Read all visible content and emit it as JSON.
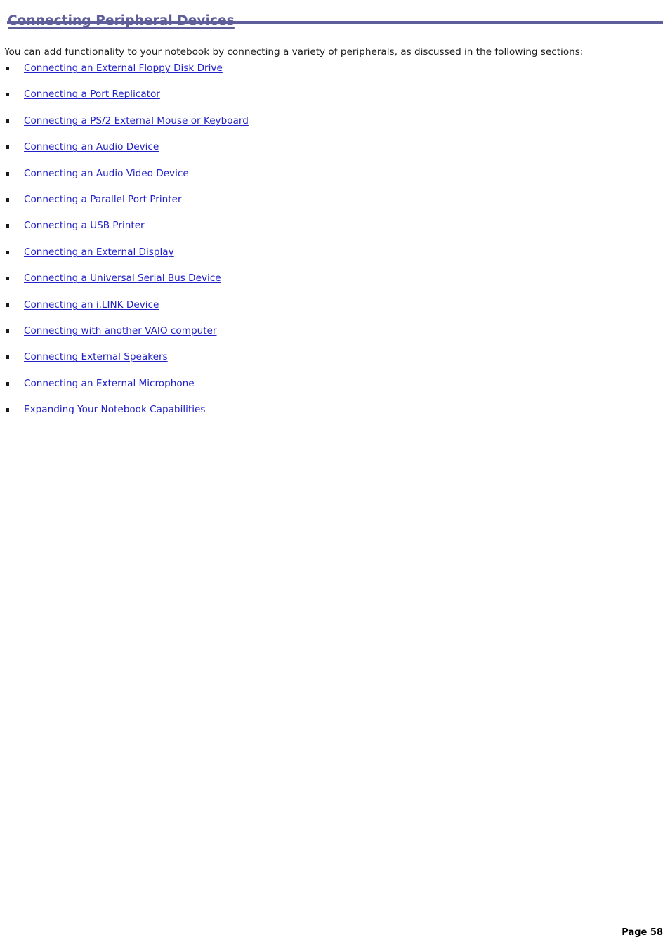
{
  "document": {
    "heading": "Connecting Peripheral Devices",
    "intro": "You can add functionality to your notebook by connecting a variety of peripherals, as discussed in the following sections:",
    "accent_color": "#5e5e9a",
    "link_color": "#2121c7",
    "bullet_icon": "square-bullet-icon",
    "links": [
      {
        "label": "Connecting an External Floppy Disk Drive"
      },
      {
        "label": "Connecting a Port Replicator"
      },
      {
        "label": "Connecting a PS/2 External Mouse or Keyboard"
      },
      {
        "label": "Connecting an Audio Device"
      },
      {
        "label": "Connecting an Audio-Video Device"
      },
      {
        "label": "Connecting a Parallel Port Printer"
      },
      {
        "label": "Connecting a USB Printer"
      },
      {
        "label": "Connecting an External Display"
      },
      {
        "label": "Connecting a Universal Serial Bus Device"
      },
      {
        "label": "Connecting an i.LINK Device"
      },
      {
        "label": "Connecting with another VAIO computer"
      },
      {
        "label": "Connecting External Speakers"
      },
      {
        "label": "Connecting an External Microphone"
      },
      {
        "label": "Expanding Your Notebook Capabilities"
      }
    ],
    "footer": "Page 58"
  }
}
